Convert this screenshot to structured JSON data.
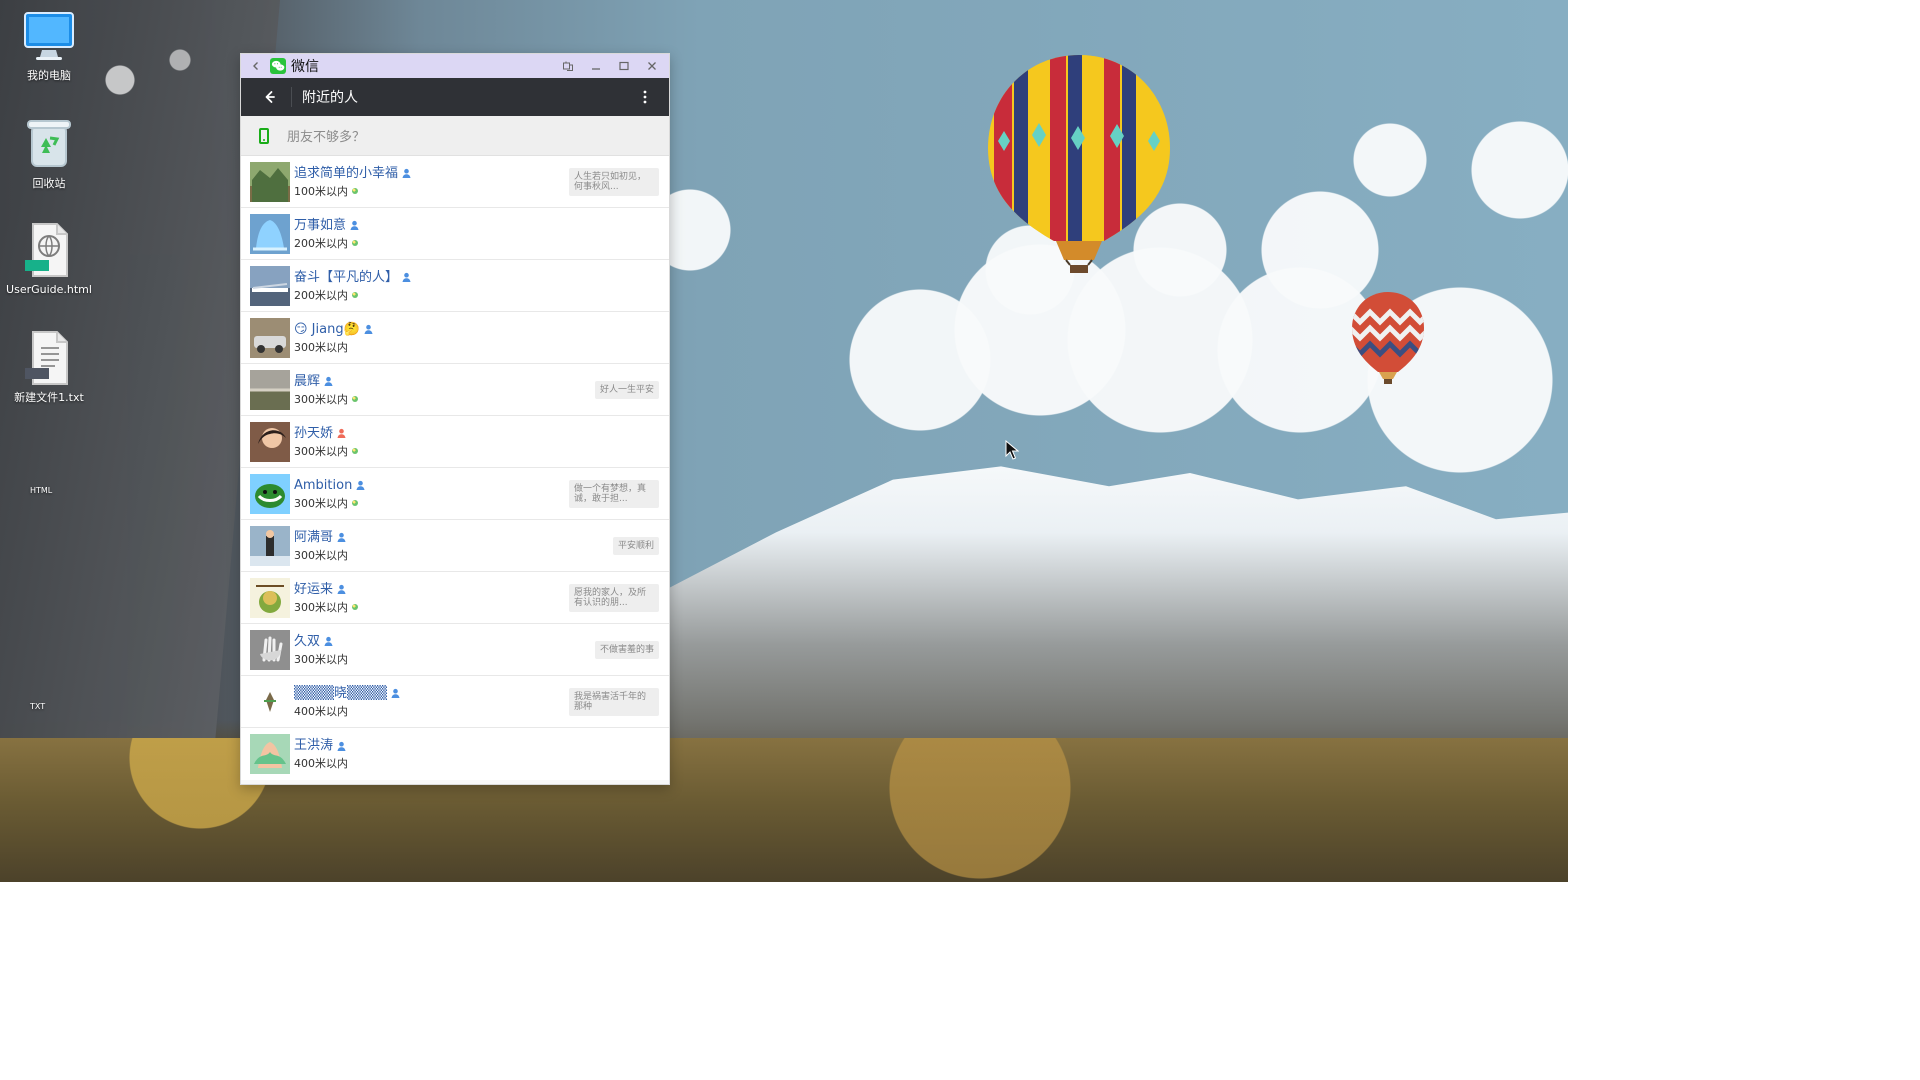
{
  "desktop": {
    "icons": [
      {
        "label": "我的电脑",
        "icon": "computer-icon"
      },
      {
        "label": "回收站",
        "icon": "recycle-bin-icon"
      },
      {
        "label": "UserGuide.html",
        "icon": "html-file-icon",
        "badge": "HTML"
      },
      {
        "label": "新建文件1.txt",
        "icon": "text-file-icon",
        "badge": "TXT"
      }
    ]
  },
  "window": {
    "app_name": "微信",
    "back_icon": "chevron-left-icon",
    "app_icon": "wechat-icon",
    "actions": [
      "screenshot-icon",
      "minimize-icon",
      "maximize-icon",
      "close-icon"
    ]
  },
  "header": {
    "title": "附近的人",
    "back_icon": "arrow-left-icon",
    "more_icon": "more-vertical-icon"
  },
  "prompt": {
    "text": "朋友不够多？",
    "icon": "phone-icon"
  },
  "items": [
    {
      "name": "追求简单的小幸福",
      "distance": "100米以内",
      "signature": "人生若只如初见，何事秋风...",
      "gender": "male",
      "online": true
    },
    {
      "name": "万事如意",
      "distance": "200米以内",
      "signature": "",
      "gender": "male",
      "online": true
    },
    {
      "name": "奋斗【平凡的人】",
      "distance": "200米以内",
      "signature": "",
      "gender": "male",
      "online": true
    },
    {
      "name": "😏 Jiang🤔",
      "distance": "300米以内",
      "signature": "",
      "gender": "male",
      "online": false
    },
    {
      "name": "晨辉",
      "distance": "300米以内",
      "signature": "好人一生平安",
      "gender": "male",
      "online": true
    },
    {
      "name": "孙天娇",
      "distance": "300米以内",
      "signature": "",
      "gender": "female",
      "online": true
    },
    {
      "name": "Ambition",
      "distance": "300米以内",
      "signature": "做一个有梦想，真诚，敢于担...",
      "gender": "male",
      "online": true
    },
    {
      "name": "阿满哥",
      "distance": "300米以内",
      "signature": "平安顺利",
      "gender": "male",
      "online": false
    },
    {
      "name": "好运来",
      "distance": "300米以内",
      "signature": "愿我的家人，及所有认识的朋...",
      "gender": "male",
      "online": true
    },
    {
      "name": "久双",
      "distance": "300米以内",
      "signature": "不做害羞的事",
      "gender": "male",
      "online": false
    },
    {
      "name": "▒▒▒▒晓▒▒▒▒",
      "distance": "400米以内",
      "signature": "我是祸害活千年的那种",
      "gender": "male",
      "online": false
    },
    {
      "name": "王洪涛",
      "distance": "400米以内",
      "signature": "",
      "gender": "male",
      "online": false
    }
  ],
  "colors": {
    "titlebar": "#dcd7f4",
    "header": "#2f3136",
    "accent_green": "#1aad19",
    "name_blue": "#2f5ea8"
  }
}
